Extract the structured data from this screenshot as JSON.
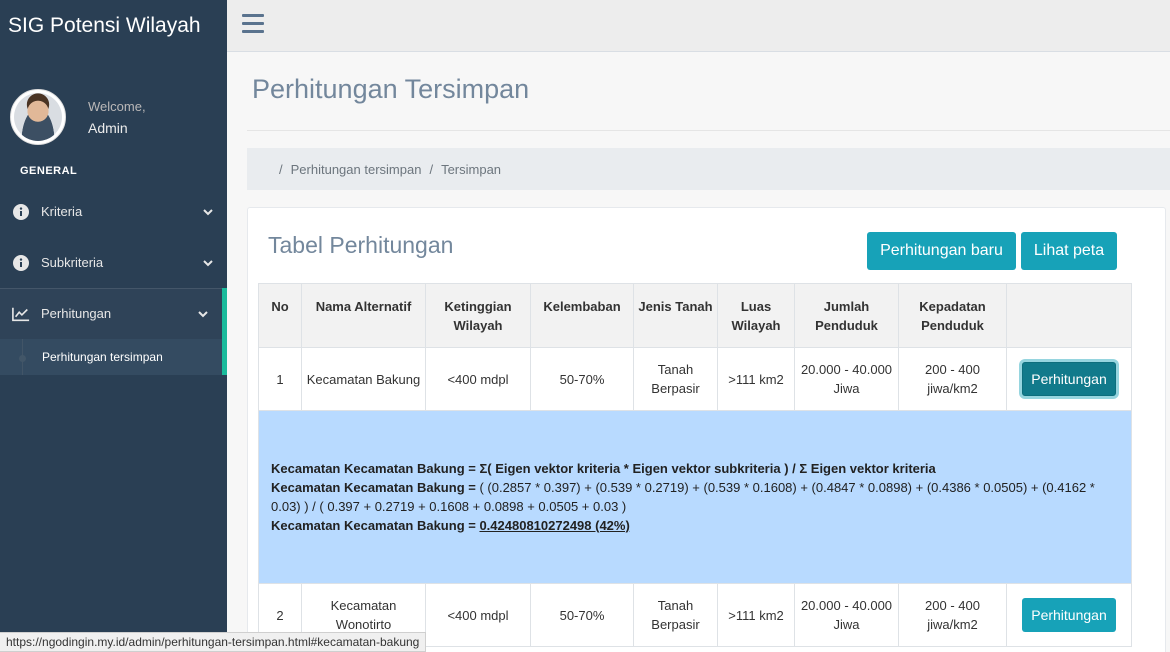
{
  "brand": "SIG Potensi Wilayah",
  "profile": {
    "welcome": "Welcome,",
    "name": "Admin"
  },
  "sidebar": {
    "section": "GENERAL",
    "items": [
      {
        "label": "Kriteria",
        "icon": "info-circle-icon"
      },
      {
        "label": "Subkriteria",
        "icon": "info-circle-icon"
      },
      {
        "label": "Perhitungan",
        "icon": "line-chart-icon"
      }
    ],
    "submenu": "Perhitungan tersimpan"
  },
  "page": {
    "title": "Perhitungan Tersimpan"
  },
  "breadcrumb": {
    "sep": "/",
    "item1": "Perhitungan tersimpan",
    "item2": "Tersimpan"
  },
  "panel": {
    "title": "Tabel Perhitungan",
    "btn_new": "Perhitungan baru",
    "btn_map": "Lihat peta"
  },
  "table": {
    "headers": [
      "No",
      "Nama Alternatif",
      "Ketinggian Wilayah",
      "Kelembaban",
      "Jenis Tanah",
      "Luas Wilayah",
      "Jumlah Penduduk",
      "Kepadatan Penduduk",
      ""
    ],
    "rows": [
      {
        "no": "1",
        "nama": "Kecamatan Bakung",
        "ketinggian": "<400 mdpl",
        "kelembaban": "50-70%",
        "jenis": "Tanah Berpasir",
        "luas": ">111 km2",
        "jumlah": "20.000 - 40.000 Jiwa",
        "kepadatan": "200 - 400 jiwa/km2",
        "action": "Perhitungan"
      },
      {
        "no": "2",
        "nama": "Kecamatan Wonotirto",
        "ketinggian": "<400 mdpl",
        "kelembaban": "50-70%",
        "jenis": "Tanah Berpasir",
        "luas": ">111 km2",
        "jumlah": "20.000 - 40.000 Jiwa",
        "kepadatan": "200 - 400 jiwa/km2",
        "action": "Perhitungan"
      }
    ],
    "detail": {
      "line1_label": "Kecamatan Kecamatan Bakung = ",
      "line1_text": "Σ( Eigen vektor kriteria * Eigen vektor subkriteria ) / Σ Eigen vektor kriteria",
      "line2_label": "Kecamatan Kecamatan Bakung = ",
      "line2_text": "( (0.2857 * 0.397) + (0.539 * 0.2719) + (0.539 * 0.1608) + (0.4847 * 0.0898) + (0.4386 * 0.0505) + (0.4162 * 0.03) ) / ( 0.397 + 0.2719 + 0.1608 + 0.0898 + 0.0505 + 0.03 )",
      "line3_label": "Kecamatan Kecamatan Bakung = ",
      "line3_text": "0.42480810272498 (42%)"
    }
  },
  "statusbar": "https://ngodingin.my.id/admin/perhitungan-tersimpan.html#kecamatan-bakung"
}
